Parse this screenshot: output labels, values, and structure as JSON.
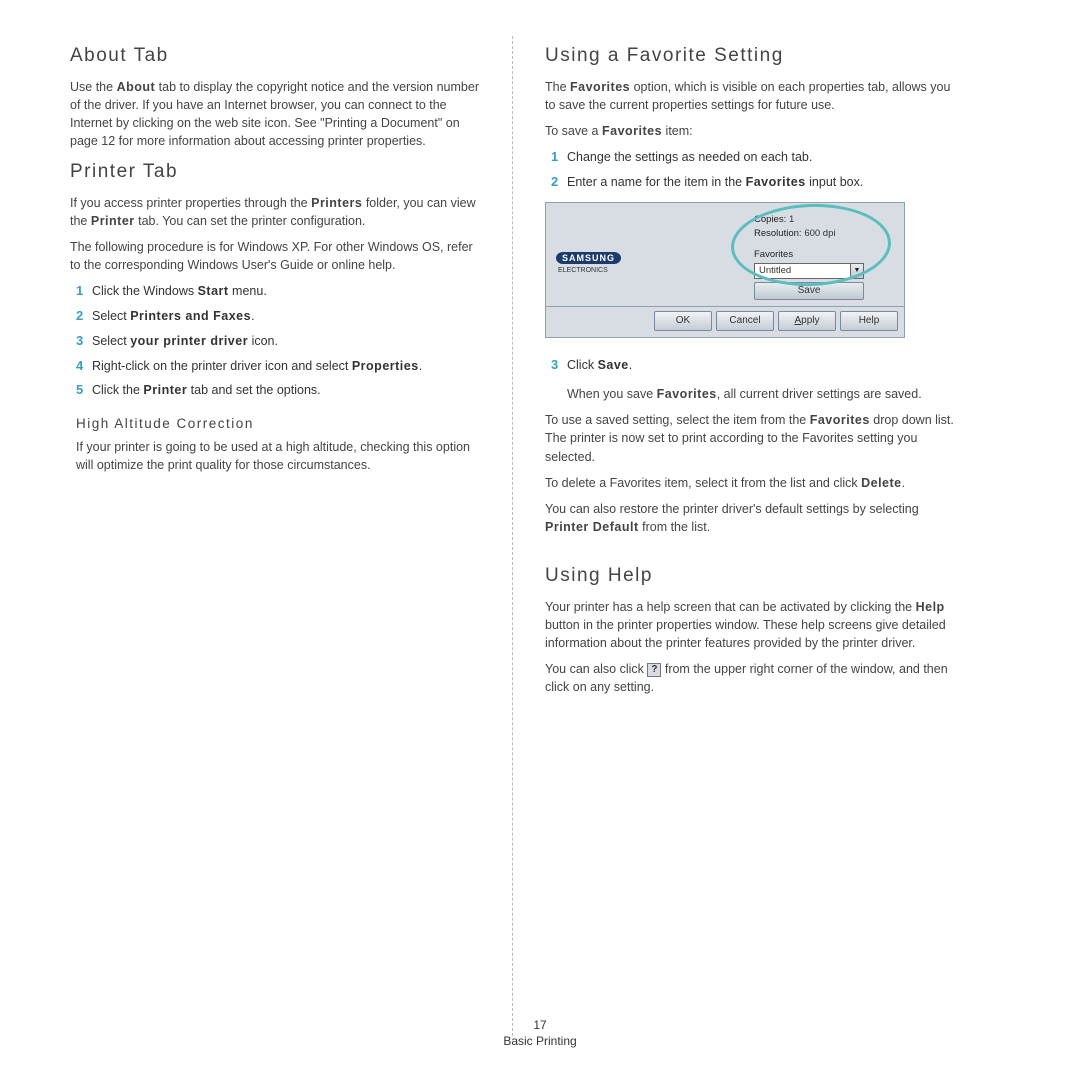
{
  "left": {
    "about": {
      "heading": "About Tab",
      "p1": "Use the About tab to display the copyright notice and the version number of the driver. If you have an Internet browser, you can connect to the Internet by clicking on the web site icon. See \"Printing a Document\" on page 12 for more information about accessing printer properties."
    },
    "printer": {
      "heading": "Printer Tab",
      "p1_a": "If you access printer properties through the ",
      "p1_b": "Printers",
      "p1_c": " folder, you can view the ",
      "p1_d": "Printer",
      "p1_e": " tab. You can set the printer configuration.",
      "p2": "The following procedure is for Windows XP. For other Windows OS, refer to the corresponding Windows User's Guide or online help.",
      "steps": {
        "s1_a": "Click the Windows ",
        "s1_b": "Start",
        "s1_c": " menu.",
        "s2_a": "Select ",
        "s2_b": "Printers and Faxes",
        "s2_c": ".",
        "s3_a": "Select ",
        "s3_b": "your printer driver",
        "s3_c": " icon.",
        "s4_a": "Right-click on the printer driver icon and select ",
        "s4_b": "Properties",
        "s4_c": ".",
        "s5_a": "Click the ",
        "s5_b": "Printer",
        "s5_c": " tab and set the options."
      },
      "h_alt": "High Altitude Correction",
      "p_alt": "If your printer is going to be used at a high altitude, checking this option will optimize the print quality for those circumstances."
    }
  },
  "right": {
    "fav": {
      "heading": "Using a Favorite Setting",
      "p1_a": "The ",
      "p1_b": "Favorites",
      "p1_c": " option, which is visible on each properties tab, allows you to save the current properties settings for future use.",
      "p2_a": "To save a ",
      "p2_b": "Favorites",
      "p2_c": " item:",
      "steps": {
        "s1": "Change the settings as needed on each tab.",
        "s2_a": "Enter a name for the item in the ",
        "s2_b": "Favorites",
        "s2_c": " input box.",
        "s3_a": "Click ",
        "s3_b": "Save",
        "s3_c": "."
      },
      "p_saved_a": "When you save ",
      "p_saved_b": "Favorites",
      "p_saved_c": ", all current driver settings are saved.",
      "p3_a": "To use a saved setting, select the item from the ",
      "p3_b": "Favorites",
      "p3_c": " drop down list. The printer is now set to print according to the Favorites setting you selected.",
      "p4_a": "To delete a Favorites item, select it from the list and click ",
      "p4_b": "Delete",
      "p4_c": ".",
      "p5_a": "You can also restore the printer driver's default settings by selecting ",
      "p5_b": "Printer Default",
      "p5_c": " from the list."
    },
    "help": {
      "heading": "Using Help",
      "p1_a": "Your printer has a help screen that can be activated by clicking the ",
      "p1_b": "Help",
      "p1_c": " button in the printer properties window. These help screens give detailed information about the printer features provided by the printer driver.",
      "p2_a": "You can also click ",
      "p2_b": " from the upper right corner of the window, and then click on any setting."
    }
  },
  "dialog": {
    "copies_label": "Copies:",
    "copies_val": "1",
    "res_label": "Resolution:",
    "res_val": "600 dpi",
    "fav_label": "Favorites",
    "fav_value": "Untitled",
    "save_label": "Save",
    "brand": "SAMSUNG",
    "brand_sub": "ELECTRONICS",
    "buttons": {
      "ok": "OK",
      "cancel": "Cancel",
      "apply": "Apply",
      "help": "Help"
    }
  },
  "footer": {
    "page_num": "17",
    "section": "Basic Printing"
  }
}
